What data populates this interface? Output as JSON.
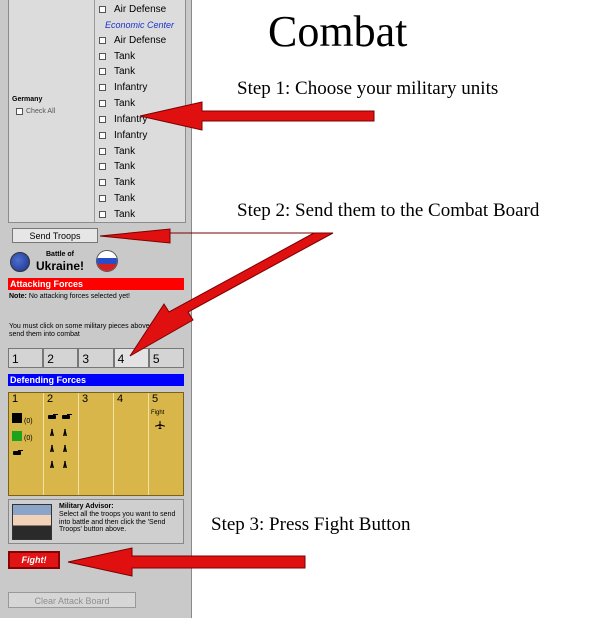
{
  "heading": "Combat",
  "steps": [
    "Step 1: Choose your military units",
    "Step 2: Send them to the Combat Board",
    "Step 3: Press Fight Button"
  ],
  "units_panel": {
    "country": "Germany",
    "check_all": "Check All",
    "sections": [
      {
        "label": "",
        "units": [
          "Air Defense"
        ]
      },
      {
        "label": "Economic Center",
        "units": [
          "Air Defense",
          "Tank",
          "Tank",
          "Infantry",
          "Tank",
          "Infantry",
          "Infantry",
          "Tank",
          "Tank",
          "Tank",
          "Tank",
          "Tank"
        ]
      }
    ]
  },
  "send_troops_button": "Send Troops",
  "battle": {
    "of_label": "Battle of",
    "name": "Ukraine!"
  },
  "attacking": {
    "title": "Attacking Forces",
    "note_label": "Note:",
    "note_text": "No attacking forces selected yet!",
    "message": "You must click on some military pieces above to send them into combat",
    "slots": [
      "1",
      "2",
      "3",
      "4",
      "5"
    ]
  },
  "defending": {
    "title": "Defending Forces",
    "slots": [
      "1",
      "2",
      "3",
      "4",
      "5"
    ],
    "slot1_counts": [
      "(0)",
      "(0)"
    ],
    "slot5_label": "Fight"
  },
  "advisor": {
    "title": "Military Advisor:",
    "text": "Select all the troops you want to send into battle and then click the 'Send Troops' button above."
  },
  "fight_button": "Fight!",
  "clear_button": "Clear Attack Board",
  "colors": {
    "attack_bar": "#ff0000",
    "defend_bar": "#0000ff",
    "arrow": "#e01010",
    "defend_board": "#d8b64a"
  }
}
